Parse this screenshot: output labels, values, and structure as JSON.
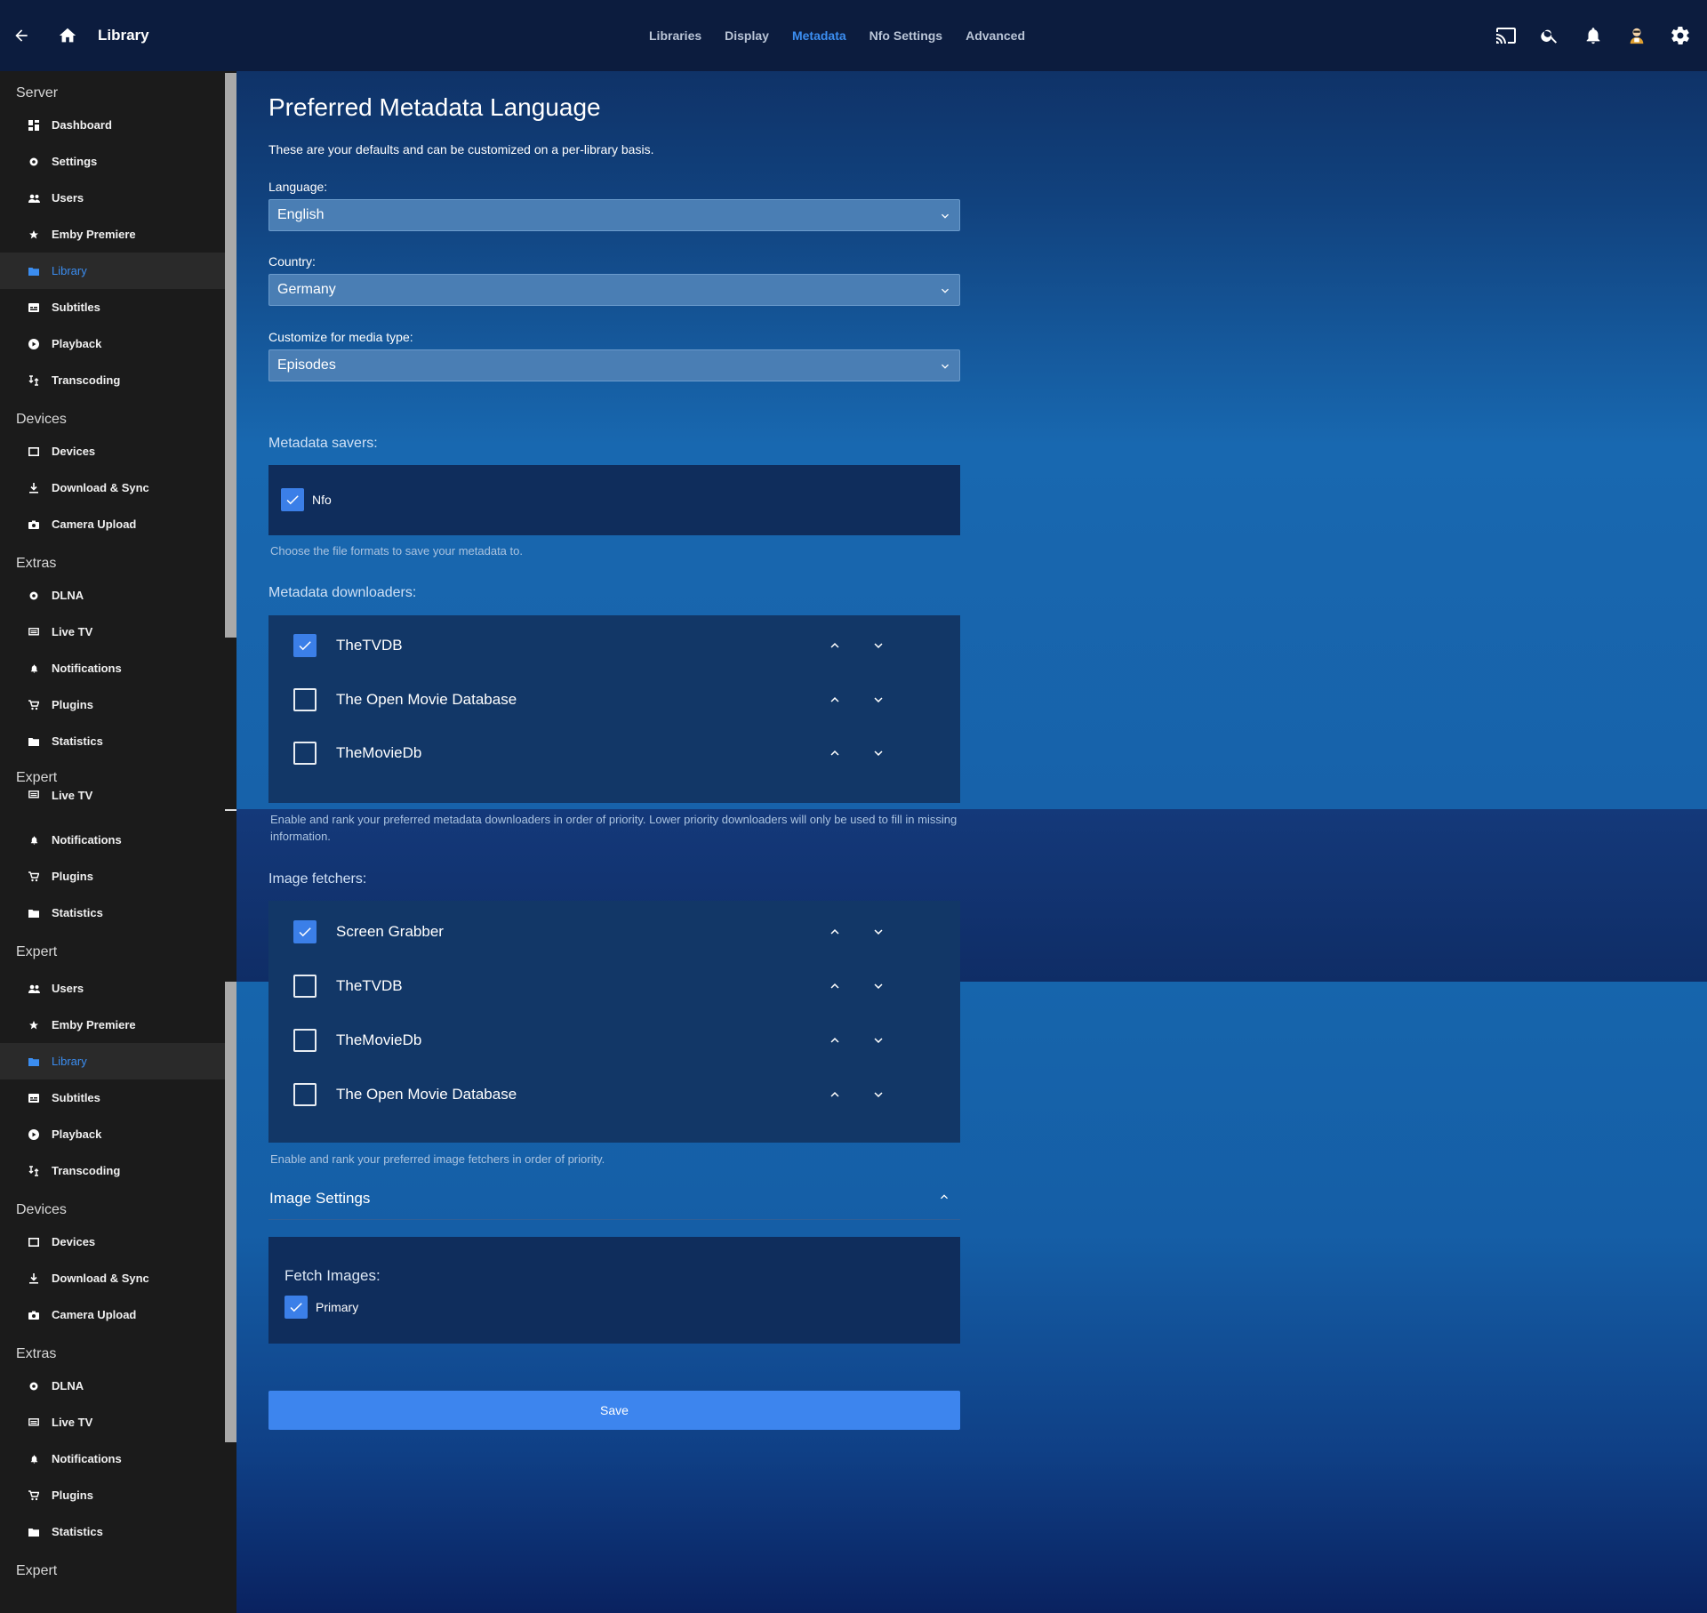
{
  "header": {
    "title": "Library",
    "back_icon": "back-arrow-icon",
    "home_icon": "home-icon",
    "tabs": [
      {
        "label": "Libraries",
        "active": false
      },
      {
        "label": "Display",
        "active": false
      },
      {
        "label": "Metadata",
        "active": true
      },
      {
        "label": "Nfo Settings",
        "active": false
      },
      {
        "label": "Advanced",
        "active": false
      }
    ],
    "right_icons": [
      "cast-icon",
      "search-icon",
      "bell-icon",
      "avatar",
      "gear-icon"
    ]
  },
  "sidebar": {
    "groups": [
      {
        "section": "Server",
        "items": [
          "Dashboard",
          "Settings",
          "Users",
          "Emby Premiere",
          "Library",
          "Subtitles",
          "Playback",
          "Transcoding"
        ]
      },
      {
        "section": "Devices",
        "items": [
          "Devices",
          "Download & Sync",
          "Camera Upload"
        ]
      },
      {
        "section": "Extras",
        "items": [
          "DLNA",
          "Live TV",
          "Notifications",
          "Plugins",
          "Statistics"
        ]
      },
      {
        "section": "Expert",
        "items": [
          "Live TV",
          "Notifications",
          "Plugins",
          "Statistics"
        ]
      },
      {
        "section": "Expert",
        "items": [
          "Users",
          "Emby Premiere",
          "Library",
          "Subtitles",
          "Playback",
          "Transcoding"
        ]
      },
      {
        "section": "Devices",
        "items": [
          "Devices",
          "Download & Sync",
          "Camera Upload"
        ]
      },
      {
        "section": "Extras",
        "items": [
          "DLNA",
          "Live TV",
          "Notifications",
          "Plugins",
          "Statistics"
        ]
      },
      {
        "section": "Expert",
        "items": []
      }
    ],
    "active_item": "Library"
  },
  "main": {
    "title": "Preferred Metadata Language",
    "description": "These are your defaults and can be customized on a per-library basis.",
    "language": {
      "label": "Language:",
      "value": "English"
    },
    "country": {
      "label": "Country:",
      "value": "Germany"
    },
    "media_type": {
      "label": "Customize for media type:",
      "value": "Episodes"
    },
    "savers": {
      "label": "Metadata savers:",
      "items": [
        {
          "name": "Nfo",
          "checked": true
        }
      ],
      "help": "Choose the file formats to save your metadata to."
    },
    "downloaders": {
      "label": "Metadata downloaders:",
      "items": [
        {
          "name": "TheTVDB",
          "checked": true
        },
        {
          "name": "The Open Movie Database",
          "checked": false
        },
        {
          "name": "TheMovieDb",
          "checked": false
        }
      ],
      "help": "Enable and rank your preferred metadata downloaders in order of priority. Lower priority downloaders will only be used to fill in missing information."
    },
    "image_fetchers": {
      "label": "Image fetchers:",
      "items": [
        {
          "name": "Screen Grabber",
          "checked": true
        },
        {
          "name": "TheTVDB",
          "checked": false
        },
        {
          "name": "TheMovieDb",
          "checked": false
        },
        {
          "name": "The Open Movie Database",
          "checked": false
        }
      ],
      "help": "Enable and rank your preferred image fetchers in order of priority."
    },
    "image_settings": {
      "title": "Image Settings",
      "fetch_label": "Fetch Images:",
      "items": [
        {
          "name": "Primary",
          "checked": true
        }
      ]
    },
    "save_label": "Save"
  },
  "colors": {
    "accent": "#3b8df0",
    "header_bg": "#0c1c3e",
    "sidebar_bg": "#1b1b1b",
    "checkbox_checked": "#3b7fe8",
    "save_button": "#3d85ee"
  }
}
